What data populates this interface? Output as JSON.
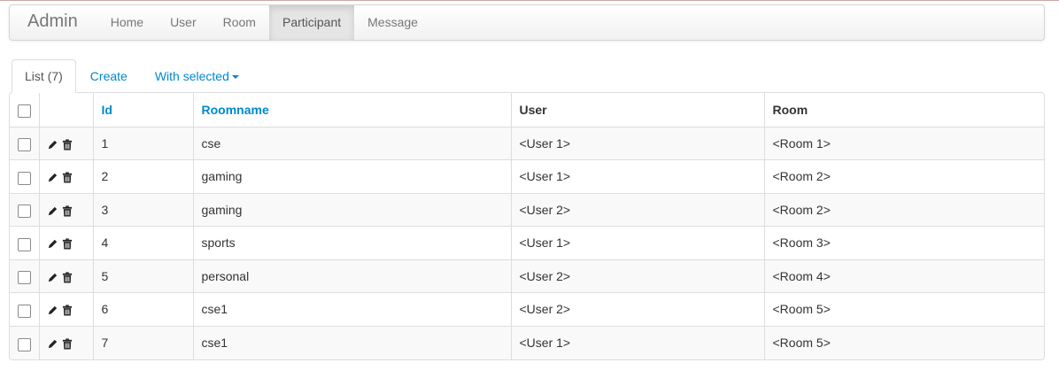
{
  "navbar": {
    "brand": "Admin",
    "items": [
      {
        "label": "Home",
        "active": false
      },
      {
        "label": "User",
        "active": false
      },
      {
        "label": "Room",
        "active": false
      },
      {
        "label": "Participant",
        "active": true
      },
      {
        "label": "Message",
        "active": false
      }
    ]
  },
  "tabs": {
    "list": "List (7)",
    "create": "Create",
    "with_selected": "With selected"
  },
  "table": {
    "columns": {
      "id": "Id",
      "roomname": "Roomname",
      "user": "User",
      "room": "Room"
    },
    "rows": [
      {
        "id": "1",
        "roomname": "cse",
        "user": "<User 1>",
        "room": "<Room 1>"
      },
      {
        "id": "2",
        "roomname": "gaming",
        "user": "<User 1>",
        "room": "<Room 2>"
      },
      {
        "id": "3",
        "roomname": "gaming",
        "user": "<User 2>",
        "room": "<Room 2>"
      },
      {
        "id": "4",
        "roomname": "sports",
        "user": "<User 1>",
        "room": "<Room 3>"
      },
      {
        "id": "5",
        "roomname": "personal",
        "user": "<User 2>",
        "room": "<Room 4>"
      },
      {
        "id": "6",
        "roomname": "cse1",
        "user": "<User 2>",
        "room": "<Room 5>"
      },
      {
        "id": "7",
        "roomname": "cse1",
        "user": "<User 1>",
        "room": "<Room 5>"
      }
    ]
  },
  "icons": {
    "edit": "pencil-icon",
    "delete": "trash-icon"
  },
  "colors": {
    "link": "#0088cc",
    "nav_active_bg": "#e5e5e5"
  }
}
